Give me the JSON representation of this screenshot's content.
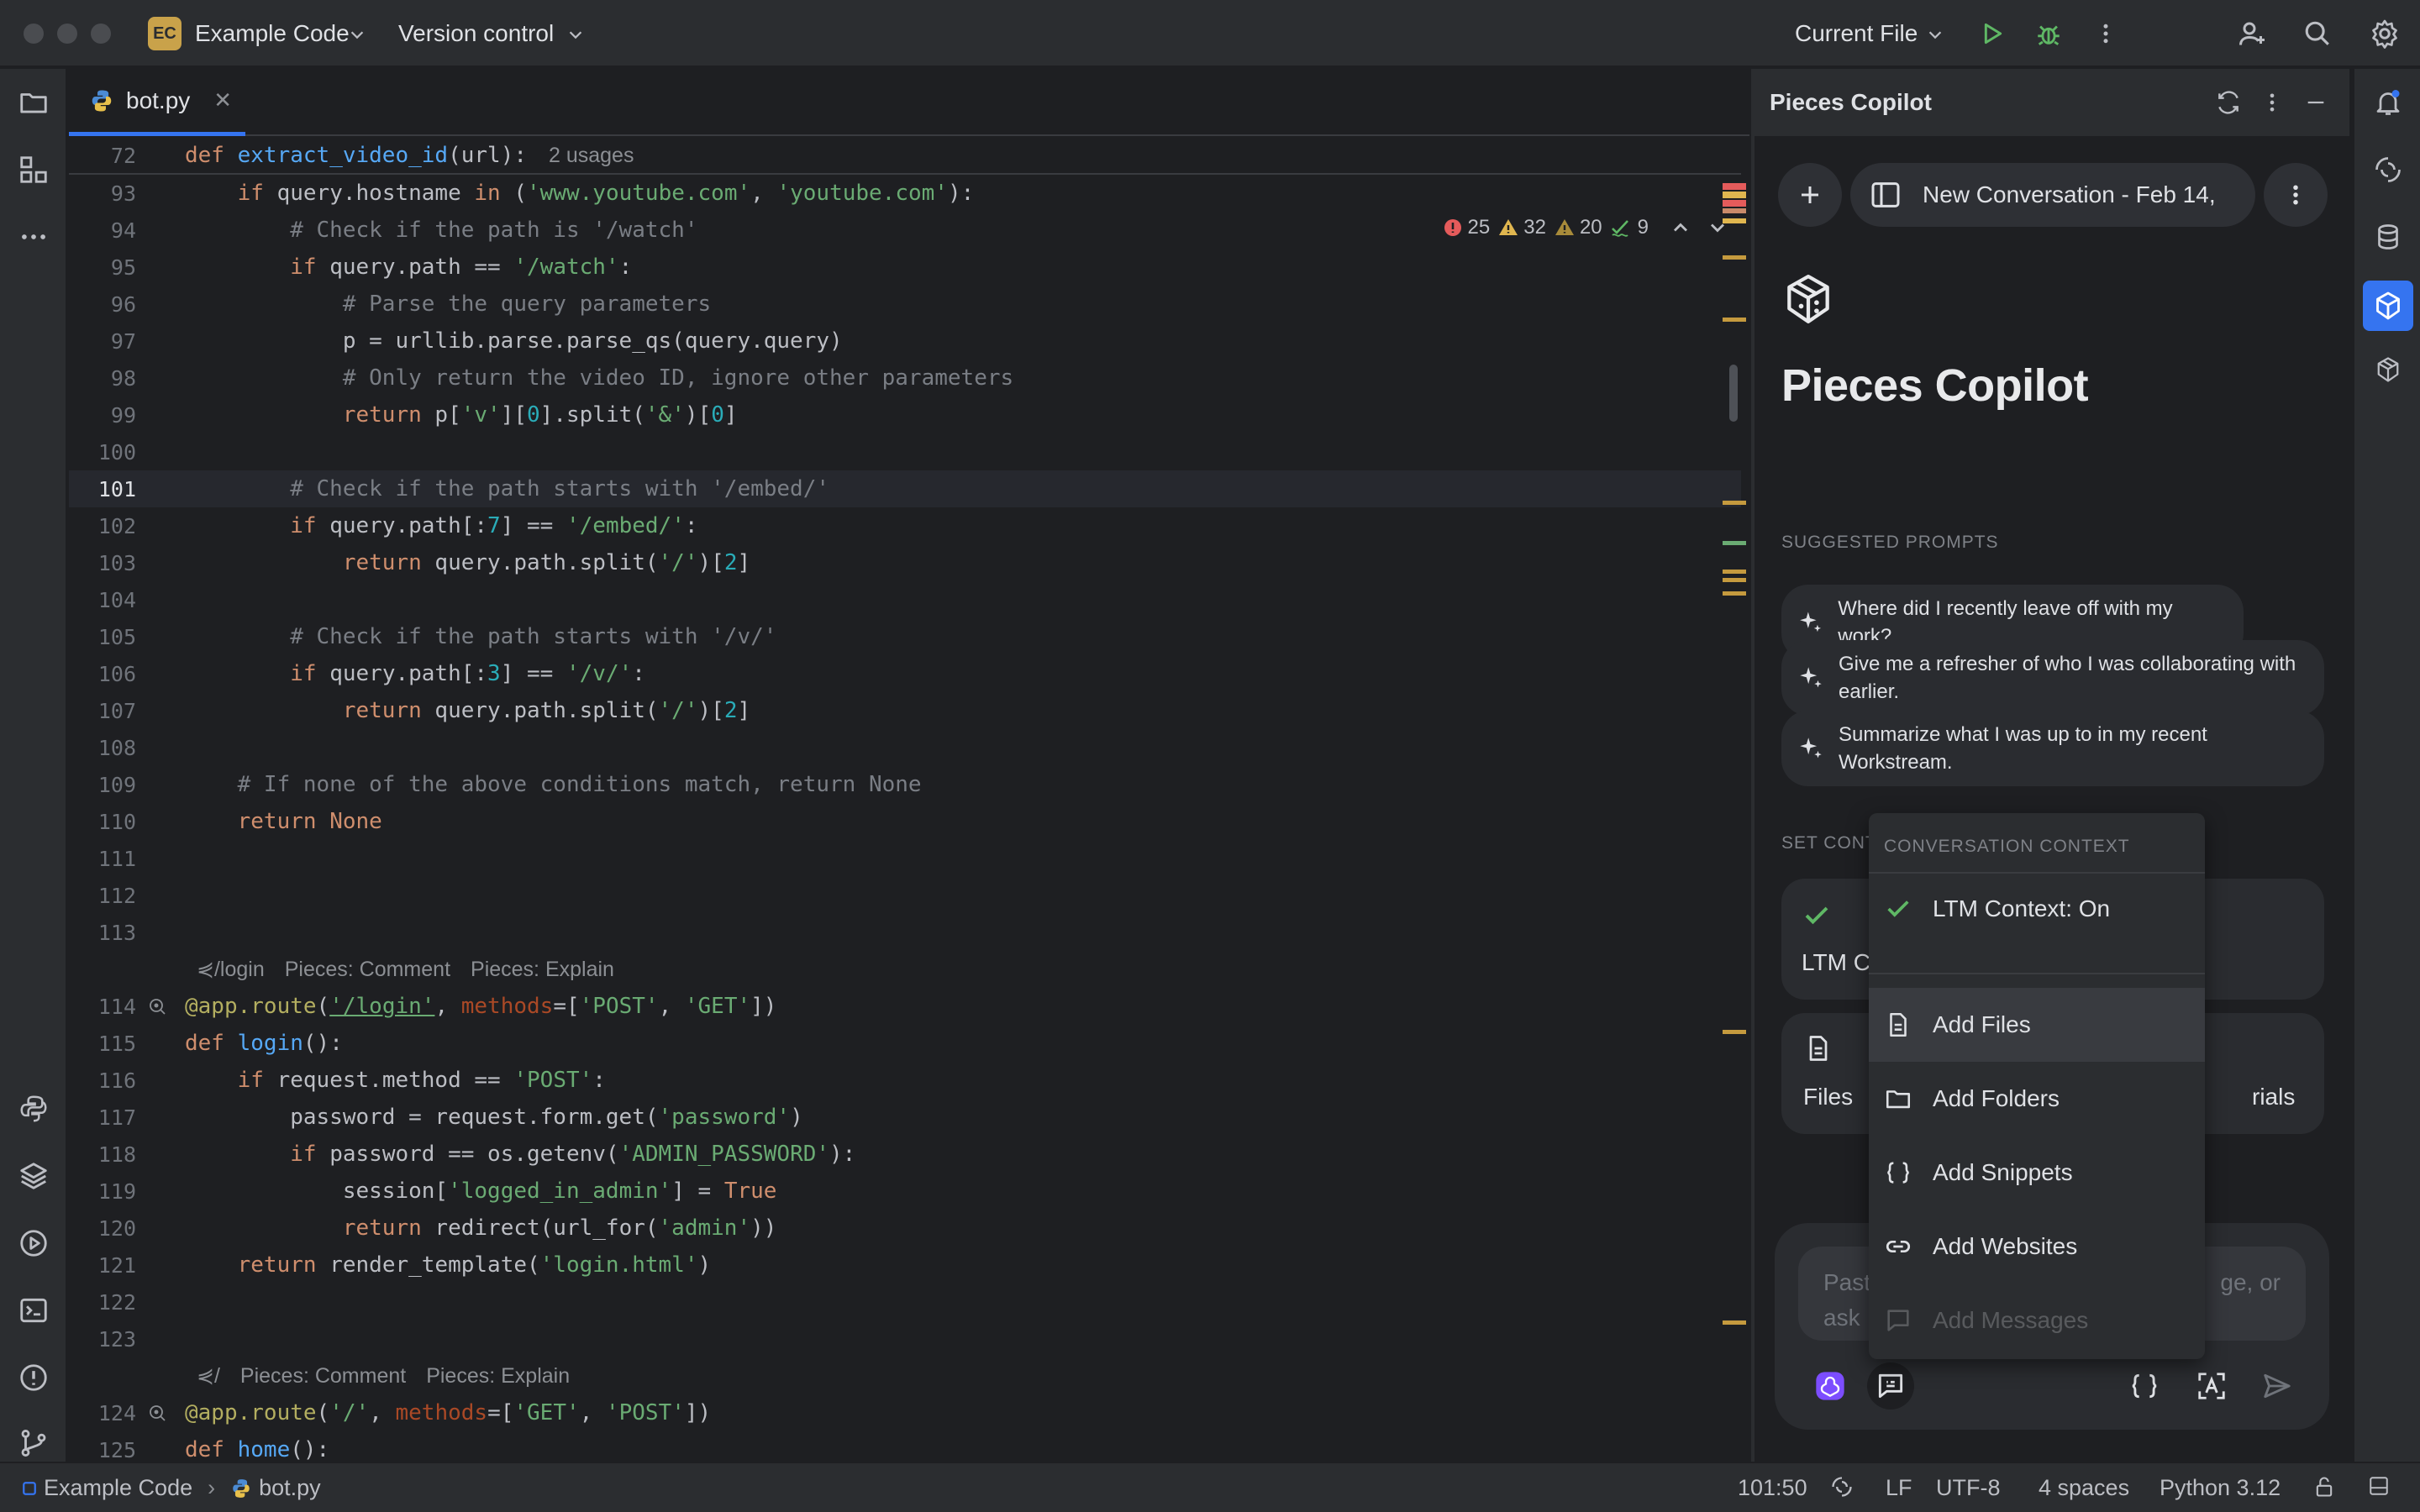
{
  "titlebar": {
    "project_initials": "EC",
    "project_name": "Example Code",
    "version_control": "Version control",
    "run_config": "Current File"
  },
  "editor": {
    "tab_name": "bot.py",
    "sticky_line_number": "72",
    "sticky_usages": "2 usages",
    "inspections": {
      "errors": "25",
      "warnings": "32",
      "weak_warnings": "20",
      "typos": "9"
    },
    "lens_login": {
      "route": "/login",
      "comment": "Pieces: Comment",
      "explain": "Pieces: Explain"
    },
    "lens_home": {
      "route": "/",
      "comment": "Pieces: Comment",
      "explain": "Pieces: Explain"
    },
    "lines": [
      {
        "n": "93"
      },
      {
        "n": "94"
      },
      {
        "n": "95"
      },
      {
        "n": "96"
      },
      {
        "n": "97"
      },
      {
        "n": "98"
      },
      {
        "n": "99"
      },
      {
        "n": "100"
      },
      {
        "n": "101"
      },
      {
        "n": "102"
      },
      {
        "n": "103"
      },
      {
        "n": "104"
      },
      {
        "n": "105"
      },
      {
        "n": "106"
      },
      {
        "n": "107"
      },
      {
        "n": "108"
      },
      {
        "n": "109"
      },
      {
        "n": "110"
      },
      {
        "n": "111"
      },
      {
        "n": "112"
      },
      {
        "n": "113"
      },
      {
        "n": "114"
      },
      {
        "n": "115"
      },
      {
        "n": "116"
      },
      {
        "n": "117"
      },
      {
        "n": "118"
      },
      {
        "n": "119"
      },
      {
        "n": "120"
      },
      {
        "n": "121"
      },
      {
        "n": "122"
      },
      {
        "n": "123"
      },
      {
        "n": "124"
      },
      {
        "n": "125"
      }
    ]
  },
  "copilot": {
    "panel_title": "Pieces Copilot",
    "conversation_title": "New Conversation - Feb 14,",
    "hero_title": "Pieces Copilot",
    "suggested_label": "SUGGESTED PROMPTS",
    "prompts": [
      {
        "line1": "Where did I recently leave off with my work?",
        "line2": ""
      },
      {
        "line1": "Give me a refresher of who I was collaborating with",
        "line2": "earlier."
      },
      {
        "line1": "Summarize what I was up to in my recent",
        "line2": "Workstream."
      }
    ],
    "set_context_label": "SET CONTEXT",
    "ctx_card_ltm_partial": "LTM C",
    "ctx_card_files": "Files",
    "ctx_card_materials_partial": "rials",
    "composer_placeholder_line1": "Past",
    "composer_placeholder_line1_end": "ge, or",
    "composer_placeholder_line2": "ask"
  },
  "context_menu": {
    "header": "CONVERSATION CONTEXT",
    "ltm": "LTM Context: On",
    "items": [
      "Add Files",
      "Add Folders",
      "Add Snippets",
      "Add Websites",
      "Add Messages"
    ]
  },
  "statusbar": {
    "project": "Example Code",
    "file": "bot.py",
    "position": "101:50",
    "line_ending": "LF",
    "encoding": "UTF-8",
    "indent": "4 spaces",
    "interpreter": "Python 3.12"
  },
  "colors": {
    "accent": "#3574f0",
    "run_green": "#5fb865",
    "error_red": "#e55b5b",
    "warning_yellow": "#e0b64f"
  }
}
